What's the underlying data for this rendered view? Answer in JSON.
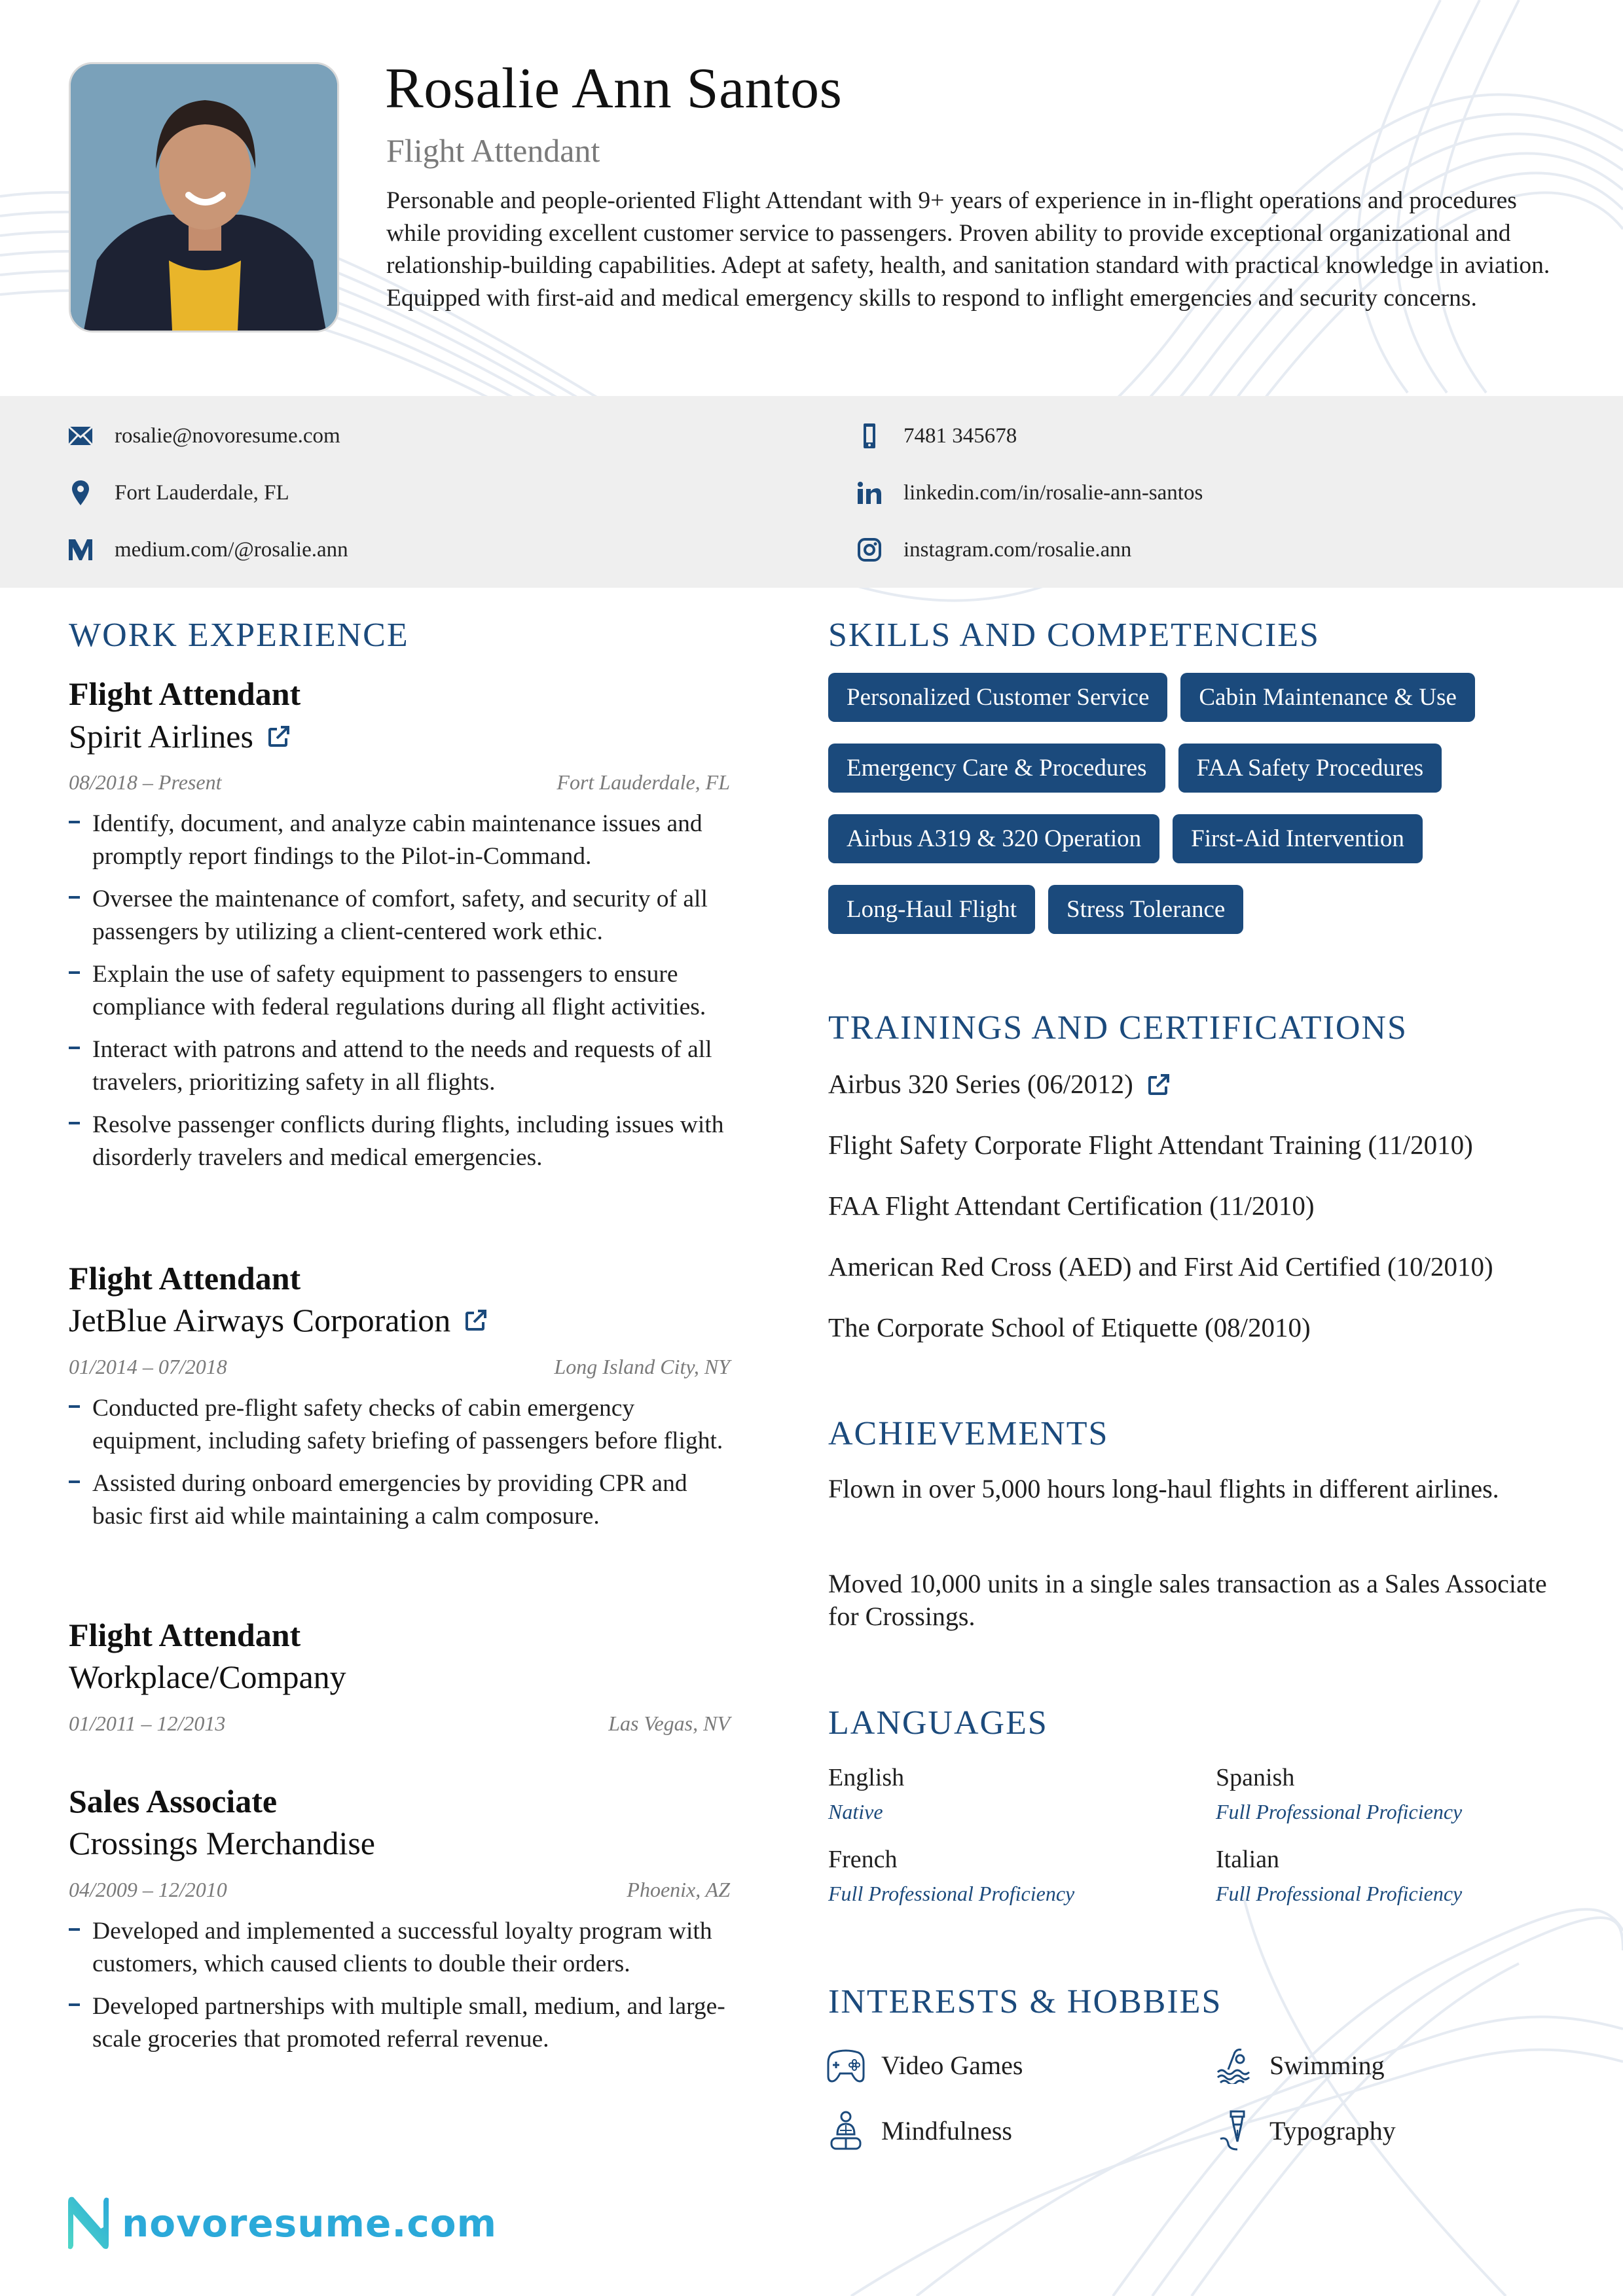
{
  "header": {
    "name": "Rosalie Ann Santos",
    "title": "Flight Attendant",
    "summary": "Personable and people-oriented Flight Attendant with 9+ years of experience in in-flight operations and procedures while providing excellent customer service to passengers. Proven ability to provide exceptional organizational and relationship-building capabilities. Adept at safety, health, and sanitation standard with practical knowledge in aviation. Equipped with first-aid and medical emergency skills to respond to inflight emergencies and security concerns.",
    "photo_alt": "profile-photo"
  },
  "contact": {
    "email": "rosalie@novoresume.com",
    "location": "Fort Lauderdale, FL",
    "medium": "medium.com/@rosalie.ann",
    "phone": "7481 345678",
    "linkedin": "linkedin.com/in/rosalie-ann-santos",
    "instagram": "instagram.com/rosalie.ann"
  },
  "sections": {
    "work": "WORK EXPERIENCE",
    "skills": "SKILLS AND COMPETENCIES",
    "trainings": "TRAININGS AND CERTIFICATIONS",
    "achievements": "ACHIEVEMENTS",
    "languages": "LANGUAGES",
    "interests": "INTERESTS & HOBBIES"
  },
  "work": [
    {
      "role": "Flight Attendant",
      "company": "Spirit Airlines",
      "has_link": true,
      "dates": "08/2018 – Present",
      "location": "Fort Lauderdale, FL",
      "bullets": [
        "Identify, document, and analyze cabin maintenance issues and promptly report findings to the Pilot-in-Command.",
        "Oversee the maintenance of comfort, safety, and security of all passengers by utilizing a client-centered work ethic.",
        "Explain the use of safety equipment to passengers to ensure compliance with federal regulations during all flight activities.",
        "Interact with patrons and attend to the needs and requests of all travelers, prioritizing safety in all flights.",
        "Resolve passenger conflicts during flights, including issues with disorderly travelers and medical emergencies."
      ]
    },
    {
      "role": "Flight Attendant",
      "company": "JetBlue Airways Corporation",
      "has_link": true,
      "dates": "01/2014 – 07/2018",
      "location": "Long Island City, NY",
      "bullets": [
        "Conducted pre-flight safety checks of cabin emergency equipment, including safety briefing of passengers before flight.",
        "Assisted during onboard emergencies by providing CPR and basic first aid while maintaining a calm composure."
      ]
    },
    {
      "role": "Flight Attendant",
      "company": "Workplace/Company",
      "has_link": false,
      "dates": "01/2011 – 12/2013",
      "location": "Las Vegas, NV",
      "bullets": []
    },
    {
      "role": "Sales Associate",
      "company": "Crossings Merchandise",
      "has_link": false,
      "dates": "04/2009 – 12/2010",
      "location": "Phoenix, AZ",
      "bullets": [
        "Developed and implemented a successful loyalty program with customers, which caused clients to double their orders.",
        "Developed partnerships with multiple small, medium, and large- scale groceries that promoted referral revenue."
      ]
    }
  ],
  "skills": [
    "Personalized Customer Service",
    "Cabin Maintenance & Use",
    "Emergency Care & Procedures",
    "FAA Safety Procedures",
    "Airbus A319 & 320 Operation",
    "First-Aid Intervention",
    "Long-Haul Flight",
    "Stress Tolerance"
  ],
  "trainings": [
    {
      "label": "Airbus 320 Series (06/2012)",
      "has_link": true
    },
    {
      "label": "Flight Safety Corporate Flight Attendant Training (11/2010)",
      "has_link": false
    },
    {
      "label": "FAA Flight Attendant Certification (11/2010)",
      "has_link": false
    },
    {
      "label": "American Red Cross (AED) and First Aid Certified (10/2010)",
      "has_link": false
    },
    {
      "label": "The Corporate School of Etiquette (08/2010)",
      "has_link": false
    }
  ],
  "achievements": [
    "Flown in over 5,000 hours long-haul flights in different airlines.",
    "Moved 10,000 units in a single sales transaction as a Sales Associate for Crossings."
  ],
  "languages": [
    {
      "name": "English",
      "level": "Native"
    },
    {
      "name": "Spanish",
      "level": "Full Professional Proficiency"
    },
    {
      "name": "French",
      "level": "Full Professional Proficiency"
    },
    {
      "name": "Italian",
      "level": "Full Professional Proficiency"
    }
  ],
  "interests": [
    {
      "label": "Video Games",
      "icon": "gamepad-icon"
    },
    {
      "label": "Swimming",
      "icon": "swimmer-icon"
    },
    {
      "label": "Mindfulness",
      "icon": "meditation-icon"
    },
    {
      "label": "Typography",
      "icon": "fountain-pen-icon"
    }
  ],
  "footer": {
    "brand": "novoresume.com"
  },
  "colors": {
    "accent": "#1b4a7c",
    "contact_bar": "#efefef",
    "brand": "#2ba9d9",
    "meta_text": "#7a7a7a"
  }
}
